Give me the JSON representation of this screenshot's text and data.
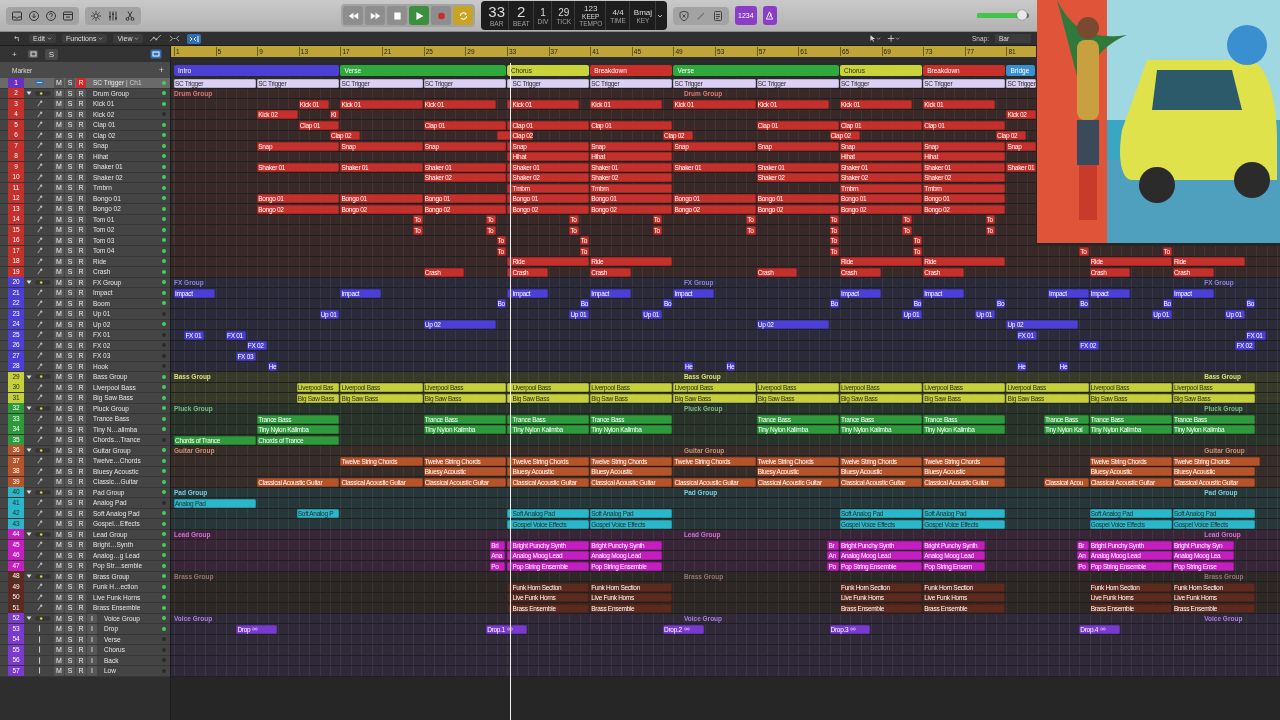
{
  "transport": [
    {
      "kind": "rewind",
      "on": false
    },
    {
      "kind": "forward",
      "on": false
    },
    {
      "kind": "stop",
      "on": false
    },
    {
      "kind": "play",
      "on": true
    },
    {
      "kind": "record",
      "on": false
    },
    {
      "kind": "cycle",
      "on": true
    }
  ],
  "lcd": [
    {
      "kind": "bar",
      "value": "33",
      "label": "BAR"
    },
    {
      "kind": "beat",
      "value": "2",
      "label": "BEAT"
    },
    {
      "kind": "div",
      "value": "1",
      "label": "DIV"
    },
    {
      "kind": "tick",
      "value": "29",
      "label": "TICK"
    },
    {
      "kind": "tempo",
      "value": "123",
      "sub": "KEEP",
      "label": "TEMPO"
    },
    {
      "kind": "time",
      "value": "4/4",
      "label": "TIME"
    },
    {
      "kind": "key",
      "value": "Bmaj",
      "label": "KEY"
    }
  ],
  "count_in": {
    "label": "1234",
    "on": true
  },
  "metronome": {
    "on": true
  },
  "master_volume": {
    "level": 0.86
  },
  "menus": [
    "Edit",
    "Functions",
    "View"
  ],
  "catch": {
    "on": true
  },
  "snap": {
    "label": "Snap:",
    "value": "Bar"
  },
  "tools_row": {
    "add": "+",
    "solo": "S"
  },
  "track_list_header": {
    "title": "Marker",
    "add": "+"
  },
  "ruler": [
    "1",
    "5",
    "9",
    "13",
    "17",
    "21",
    "25",
    "29",
    "33",
    "37",
    "41",
    "45",
    "49",
    "53",
    "57",
    "61",
    "65",
    "69",
    "73",
    "77",
    "81"
  ],
  "markers": [
    {
      "name": "Intro",
      "color": "#4b3fd6"
    },
    {
      "name": "Verse",
      "color": "#2fa83c"
    },
    {
      "name": "Chorus",
      "color": "#c9d43a"
    },
    {
      "name": "Breakdown",
      "color": "#c9302a"
    },
    {
      "name": "Verse",
      "color": "#2fa83c"
    },
    {
      "name": "Chorus",
      "color": "#c9d43a"
    },
    {
      "name": "Breakdown",
      "color": "#c9302a"
    },
    {
      "name": "Bridge",
      "color": "#3a8fd0"
    }
  ],
  "tracks": [
    {
      "number": "1",
      "name": "SC Trigger",
      "channel": "| Ch1",
      "kind": "trigger",
      "color": "#6b2fbf",
      "selected": true,
      "record": true,
      "active": true,
      "buttons": [
        "M",
        "S",
        "R"
      ],
      "regions": [
        "SC Trigger",
        "SC Trigger",
        "SC Trigger",
        "SC Trigger",
        "SC Trigger",
        "SC Trigger",
        "SC Trigger",
        "SC Trigger",
        "SC Trigger",
        "SC Trigger",
        "SC Trigger"
      ]
    },
    {
      "number": "2",
      "name": "Drum Group",
      "kind": "folder",
      "color": "#c4302b",
      "expanded": true,
      "selected": false,
      "record": false,
      "active": true,
      "buttons": [
        "M",
        "S",
        "R"
      ],
      "labels": [
        "Drum Group",
        "Drum Group"
      ],
      "children": [
        {
          "number": "3",
          "name": "Kick 01",
          "kind": "track",
          "selected": false,
          "record": false,
          "active": true,
          "buttons": [
            "M",
            "S",
            "R"
          ],
          "regions": [
            "Kick 01",
            "Kick 01",
            "Kick 01",
            "Kick 01",
            "Kick 01",
            "Kick 01",
            "Kick 01",
            "Kick 01",
            "Kick 01"
          ]
        },
        {
          "number": "4",
          "name": "Kick 02",
          "kind": "track",
          "selected": false,
          "record": false,
          "active": false,
          "buttons": [
            "M",
            "S",
            "R"
          ],
          "regions": [
            "Kick 02",
            "Ki",
            "Kick 02"
          ]
        },
        {
          "number": "5",
          "name": "Clap 01",
          "kind": "track",
          "selected": false,
          "record": false,
          "active": true,
          "buttons": [
            "M",
            "S",
            "R"
          ],
          "regions": [
            "Clap 01",
            "Clap 01",
            "Clap 01",
            "Clap 01",
            "Clap 01",
            "Clap 01",
            "Clap 01"
          ]
        },
        {
          "number": "6",
          "name": "Clap 02",
          "kind": "track",
          "selected": false,
          "record": false,
          "active": true,
          "buttons": [
            "M",
            "S",
            "R"
          ],
          "regions": [
            "Clap 02",
            "Clap 02",
            "Clap 02",
            "Clap 02",
            "Clap 02"
          ]
        },
        {
          "number": "7",
          "name": "Snap",
          "kind": "track",
          "selected": false,
          "record": false,
          "active": true,
          "buttons": [
            "M",
            "S",
            "R"
          ],
          "regions": [
            "Snap",
            "Snap",
            "Snap",
            "Snap",
            "Snap",
            "Snap",
            "Snap",
            "Snap",
            "Snap",
            "Snap"
          ]
        },
        {
          "number": "8",
          "name": "Hihat",
          "kind": "track",
          "selected": false,
          "record": false,
          "active": true,
          "buttons": [
            "M",
            "S",
            "R"
          ],
          "regions": [
            "Hihat",
            "Hihat",
            "Hihat",
            "Hihat"
          ]
        },
        {
          "number": "9",
          "name": "Shaker 01",
          "kind": "track",
          "selected": false,
          "record": false,
          "active": true,
          "buttons": [
            "M",
            "S",
            "R"
          ],
          "regions": [
            "Shaker 01",
            "Shaker 01",
            "Shaker 01",
            "Shaker 01",
            "Shaker 01",
            "Shaker 01",
            "Shaker 01",
            "Shaker 01",
            "Shaker 01",
            "Shaker 01"
          ]
        },
        {
          "number": "10",
          "name": "Shaker 02",
          "kind": "track",
          "selected": false,
          "record": false,
          "active": true,
          "buttons": [
            "M",
            "S",
            "R"
          ],
          "regions": [
            "Shaker 02",
            "Shaker 02",
            "Shaker 02",
            "Shaker 02",
            "Shaker 02",
            "Shaker 02"
          ]
        },
        {
          "number": "11",
          "name": "Tmbrn",
          "kind": "track",
          "selected": false,
          "record": false,
          "active": true,
          "buttons": [
            "M",
            "S",
            "R"
          ],
          "regions": [
            "Tmbrn",
            "Tmbrn",
            "Tmbrn",
            "Tmbrn"
          ]
        },
        {
          "number": "12",
          "name": "Bongo 01",
          "kind": "track",
          "selected": false,
          "record": false,
          "active": true,
          "buttons": [
            "M",
            "S",
            "R"
          ],
          "regions": [
            "Bongo 01",
            "Bongo 01",
            "Bongo 01",
            "Bongo 01",
            "Bongo 01",
            "Bongo 01",
            "Bongo 01",
            "Bongo 01",
            "Bongo 01"
          ]
        },
        {
          "number": "13",
          "name": "Bongo 02",
          "kind": "track",
          "selected": false,
          "record": false,
          "active": true,
          "buttons": [
            "M",
            "S",
            "R"
          ],
          "regions": [
            "Bongo 02",
            "Bongo 02",
            "Bongo 02",
            "Bongo 02",
            "Bongo 02",
            "Bongo 02",
            "Bongo 02",
            "Bongo 02",
            "Bongo 02"
          ]
        },
        {
          "number": "14",
          "name": "Tom 01",
          "kind": "track",
          "selected": false,
          "record": false,
          "active": true,
          "buttons": [
            "M",
            "S",
            "R"
          ],
          "regions": [
            "To",
            "To",
            "To",
            "To",
            "To",
            "To",
            "To",
            "To"
          ]
        },
        {
          "number": "15",
          "name": "Tom 02",
          "kind": "track",
          "selected": false,
          "record": false,
          "active": true,
          "buttons": [
            "M",
            "S",
            "R"
          ],
          "regions": [
            "To",
            "To",
            "To",
            "To",
            "To",
            "To",
            "To",
            "To"
          ]
        },
        {
          "number": "16",
          "name": "Tom 03",
          "kind": "track",
          "selected": false,
          "record": false,
          "active": true,
          "buttons": [
            "M",
            "S",
            "R"
          ],
          "regions": [
            "To",
            "To",
            "To",
            "To"
          ]
        },
        {
          "number": "17",
          "name": "Tom 04",
          "kind": "track",
          "selected": false,
          "record": false,
          "active": true,
          "buttons": [
            "M",
            "S",
            "R"
          ],
          "regions": [
            "To",
            "To",
            "To",
            "To",
            "To",
            "To"
          ]
        },
        {
          "number": "18",
          "name": "Ride",
          "kind": "track",
          "selected": false,
          "record": false,
          "active": true,
          "buttons": [
            "M",
            "S",
            "R"
          ],
          "regions": [
            "Ride",
            "Ride",
            "Ride",
            "Ride",
            "Ride",
            "Ride"
          ]
        },
        {
          "number": "19",
          "name": "Crash",
          "kind": "track",
          "selected": false,
          "record": false,
          "active": true,
          "buttons": [
            "M",
            "S",
            "R"
          ],
          "regions": [
            "Crash",
            "Crash",
            "Crash",
            "Crash",
            "Crash",
            "Crash",
            "Crash",
            "Crash"
          ]
        }
      ]
    },
    {
      "number": "20",
      "name": "FX Group",
      "kind": "folder",
      "color": "#4b3fd6",
      "expanded": true,
      "selected": false,
      "record": false,
      "active": true,
      "buttons": [
        "M",
        "S",
        "R"
      ],
      "labels": [
        "FX Group",
        "FX Group",
        "FX Group"
      ],
      "children": [
        {
          "number": "21",
          "name": "Impact",
          "kind": "track",
          "selected": false,
          "record": false,
          "active": true,
          "buttons": [
            "M",
            "S",
            "R"
          ],
          "regions": [
            "Impact",
            "Impact",
            "Impact",
            "Impact",
            "Impact",
            "Impact",
            "Impact",
            "Impact",
            "Impact",
            "Impact"
          ]
        },
        {
          "number": "22",
          "name": "Boom",
          "kind": "track",
          "selected": false,
          "record": false,
          "active": true,
          "buttons": [
            "M",
            "S",
            "R"
          ],
          "regions": [
            "Bo",
            "Bo",
            "Bo",
            "Bo",
            "Bo",
            "Bo",
            "Bo",
            "Bo",
            "Bo"
          ]
        },
        {
          "number": "23",
          "name": "Up 01",
          "kind": "track",
          "selected": false,
          "record": false,
          "active": false,
          "buttons": [
            "M",
            "S",
            "R"
          ],
          "regions": [
            "Up 01",
            "Up 01",
            "Up 01",
            "Up 01",
            "Up 01",
            "Up 01",
            "Up 01"
          ]
        },
        {
          "number": "24",
          "name": "Up 02",
          "kind": "track",
          "selected": false,
          "record": false,
          "active": true,
          "buttons": [
            "M",
            "S",
            "R"
          ],
          "regions": [
            "Up 02",
            "Up 02",
            "Up 02"
          ]
        },
        {
          "number": "25",
          "name": "FX 01",
          "kind": "track",
          "selected": false,
          "record": false,
          "active": false,
          "buttons": [
            "M",
            "S",
            "R"
          ],
          "regions": [
            "FX 01",
            "FX 01",
            "FX 01",
            "FX 01"
          ]
        },
        {
          "number": "26",
          "name": "FX 02",
          "kind": "track",
          "selected": false,
          "record": false,
          "active": false,
          "buttons": [
            "M",
            "S",
            "R"
          ],
          "regions": [
            "FX 02",
            "FX 02",
            "FX 02"
          ]
        },
        {
          "number": "27",
          "name": "FX 03",
          "kind": "track",
          "selected": false,
          "record": false,
          "active": false,
          "buttons": [
            "M",
            "S",
            "R"
          ],
          "regions": [
            "FX 03"
          ]
        },
        {
          "number": "28",
          "name": "Hook",
          "kind": "track",
          "selected": false,
          "record": false,
          "active": false,
          "buttons": [
            "M",
            "S",
            "R"
          ],
          "regions": [
            "He",
            "He",
            "He",
            "He",
            "He"
          ]
        }
      ]
    },
    {
      "number": "29",
      "name": "Bass Group",
      "kind": "folder",
      "color": "#c6d03a",
      "expanded": true,
      "selected": false,
      "record": false,
      "active": true,
      "buttons": [
        "M",
        "S",
        "R"
      ],
      "labels": [
        "Bass Group",
        "Bass Group",
        "Bass Group"
      ],
      "children": [
        {
          "number": "30",
          "name": "Liverpool Bass",
          "kind": "track",
          "selected": false,
          "record": false,
          "active": true,
          "buttons": [
            "M",
            "S",
            "R"
          ],
          "regions": [
            "Liverpool Bas",
            "Liverpool Bass",
            "Liverpool Bass",
            "Liverpool Bass",
            "Liverpool Bass",
            "Liverpool Bass",
            "Liverpool Bass",
            "Liverpool Bass",
            "Liverpool Bass",
            "Liverpool Bass",
            "Liverpool Bass",
            "Liverpool Bass"
          ]
        },
        {
          "number": "31",
          "name": "Big Saw Bass",
          "kind": "track",
          "selected": false,
          "record": false,
          "active": true,
          "buttons": [
            "M",
            "S",
            "R"
          ],
          "regions": [
            "Big Saw Bass",
            "Big Saw Bass",
            "Big Saw Bass",
            "Big Saw Bass",
            "Big Saw Bass",
            "Big Saw Bass",
            "Big Saw Bass",
            "Big Saw Bass",
            "Big Saw Bass",
            "Big Saw Bass",
            "Big Saw Bass",
            "Big Saw Bass"
          ]
        }
      ]
    },
    {
      "number": "32",
      "name": "Pluck Group",
      "kind": "folder",
      "color": "#2f9a3c",
      "expanded": true,
      "selected": false,
      "record": false,
      "active": true,
      "buttons": [
        "M",
        "S",
        "R"
      ],
      "labels": [
        "Pluck Group",
        "Pluck Group",
        "Pluck Group"
      ],
      "children": [
        {
          "number": "33",
          "name": "Trance Bass",
          "kind": "track",
          "selected": false,
          "record": false,
          "active": true,
          "buttons": [
            "M",
            "S",
            "R"
          ],
          "regions": [
            "Trance Bass",
            "Trance Bass",
            "Trance Bass",
            "Trance Bass",
            "Trance Bass",
            "Trance Bass",
            "Trance Bass",
            "Trance Bass",
            "Trance Bass",
            "Trance Bass"
          ]
        },
        {
          "number": "34",
          "name": "Tiny N…alimba",
          "kind": "track",
          "selected": false,
          "record": false,
          "active": true,
          "buttons": [
            "M",
            "S",
            "R"
          ],
          "regions": [
            "Tiny Nylon Kalimba",
            "Tiny Nylon Kalimba",
            "Tiny Nylon Kalimba",
            "Tiny Nylon Kalimba",
            "Tiny Nylon Kalimba",
            "Tiny Nylon Kalimba",
            "Tiny Nylon Kalimba",
            "Tiny Nylon Kal",
            "Tiny Nylon Kalimba",
            "Tiny Nylon Kalimba"
          ]
        },
        {
          "number": "35",
          "name": "Chords…Trance",
          "kind": "track",
          "selected": false,
          "record": false,
          "active": false,
          "buttons": [
            "M",
            "S",
            "R"
          ],
          "regions": [
            "Chords of Trance",
            "Chords of Trance"
          ]
        }
      ]
    },
    {
      "number": "36",
      "name": "Guitar Group",
      "kind": "folder",
      "color": "#b5532a",
      "expanded": true,
      "selected": false,
      "record": false,
      "active": true,
      "buttons": [
        "M",
        "S",
        "R"
      ],
      "labels": [
        "Guitar Group",
        "Guitar Group",
        "Guitar Group"
      ],
      "children": [
        {
          "number": "37",
          "name": "Twelve…Chords",
          "kind": "track",
          "selected": false,
          "record": false,
          "active": true,
          "buttons": [
            "M",
            "S",
            "R"
          ],
          "regions": [
            "Twelve String Chords",
            "Twelve String Chords",
            "Twelve String Chords",
            "Twelve String Chords",
            "Twelve String Chords",
            "Twelve String Chords",
            "Twelve String Chords",
            "Twelve String Chords",
            "Twelve String Chords",
            "Twelve String Chords"
          ]
        },
        {
          "number": "38",
          "name": "Bluesy Acoustic",
          "kind": "track",
          "selected": false,
          "record": false,
          "active": true,
          "buttons": [
            "M",
            "S",
            "R"
          ],
          "regions": [
            "Bluesy Acoustic",
            "Bluesy Acoustic",
            "Bluesy Acoustic",
            "Bluesy Acoustic",
            "Bluesy Acoustic",
            "Bluesy Acoustic",
            "Bluesy Acoustic",
            "Bluesy Acoustic"
          ]
        },
        {
          "number": "39",
          "name": "Classic…Guitar",
          "kind": "track",
          "selected": false,
          "record": false,
          "active": true,
          "buttons": [
            "M",
            "S",
            "R"
          ],
          "regions": [
            "Classical Acoustic Guitar",
            "Classical Acoustic Guitar",
            "Classical Acoustic Guitar",
            "Classical Acoustic Guitar",
            "Classical Acoustic Guitar",
            "Classical Acoustic Guitar",
            "Classical Acoustic Guitar",
            "Classical Acoustic Guitar",
            "Classical Acoustic Guitar",
            "Classical Acou",
            "Classical Acoustic Guitar",
            "Classical Acoustic Guitar"
          ]
        }
      ]
    },
    {
      "number": "40",
      "name": "Pad Group",
      "kind": "folder",
      "color": "#2ab7c9",
      "expanded": true,
      "selected": false,
      "record": false,
      "active": true,
      "buttons": [
        "M",
        "S",
        "R"
      ],
      "labels": [
        "Pad Group",
        "Pad Group",
        "Pad Group"
      ],
      "children": [
        {
          "number": "41",
          "name": "Analog Pad",
          "kind": "track",
          "selected": false,
          "record": false,
          "active": false,
          "buttons": [
            "M",
            "S",
            "R"
          ],
          "regions": [
            "Analog Pad"
          ]
        },
        {
          "number": "42",
          "name": "Soft Analog Pad",
          "kind": "track",
          "selected": false,
          "record": false,
          "active": true,
          "buttons": [
            "M",
            "S",
            "R"
          ],
          "regions": [
            "Soft Analog P",
            "Soft Analog Pad",
            "Soft Analog Pad",
            "Soft Analog Pad",
            "Soft Analog Pad",
            "Soft Analog Pad",
            "Soft Analog Pad"
          ]
        },
        {
          "number": "43",
          "name": "Gospel…Effects",
          "kind": "track",
          "selected": false,
          "record": false,
          "active": true,
          "buttons": [
            "M",
            "S",
            "R"
          ],
          "regions": [
            "Gospel Voice Effects",
            "Gospel Voice Effects",
            "Gospel Voice Effects",
            "Gospel Voice Effects",
            "Gospel Voice Effects",
            "Gospel Voice Effects"
          ]
        }
      ]
    },
    {
      "number": "44",
      "name": "Lead Group",
      "kind": "folder",
      "color": "#c41ec0",
      "expanded": true,
      "selected": false,
      "record": false,
      "active": true,
      "buttons": [
        "M",
        "S",
        "R"
      ],
      "labels": [
        "Lead Group",
        "Lead Group",
        "Lead Group"
      ],
      "children": [
        {
          "number": "45",
          "name": "Bright…Synth",
          "kind": "track",
          "selected": false,
          "record": false,
          "active": true,
          "buttons": [
            "M",
            "S",
            "R"
          ],
          "regions": [
            "Bri",
            "Bright Punchy Synth",
            "Bright Punchy Synth",
            "Br",
            "Bright Punchy Synth",
            "Bright Punchy Synth",
            "Br",
            "Bright Punchy Synth",
            "Bright Punchy Syn"
          ]
        },
        {
          "number": "46",
          "name": "Analog…g Lead",
          "kind": "track",
          "selected": false,
          "record": false,
          "active": true,
          "buttons": [
            "M",
            "S",
            "R"
          ],
          "regions": [
            "Ana",
            "Analog Moog Lead",
            "Analog Moog Lead",
            "An",
            "Analog Moog Lead",
            "Analog Moog Lead",
            "An",
            "Analog Moog Lead",
            "Analog Moog Lea"
          ]
        },
        {
          "number": "47",
          "name": "Pop Str…semble",
          "kind": "track",
          "selected": false,
          "record": false,
          "active": true,
          "buttons": [
            "M",
            "S",
            "R"
          ],
          "regions": [
            "Po",
            "Pop String Ensemble",
            "Pop String Ensemble",
            "Po",
            "Pop String Ensemble",
            "Pop String Ensem",
            "Po",
            "Pop String Ensemble",
            "Pop String Ense"
          ]
        }
      ]
    },
    {
      "number": "48",
      "name": "Brass Group",
      "kind": "folder",
      "color": "#5c2a1f",
      "expanded": true,
      "selected": false,
      "record": false,
      "active": true,
      "buttons": [
        "M",
        "S",
        "R"
      ],
      "labels": [
        "Brass Group",
        "Brass Group",
        "Brass Group"
      ],
      "children": [
        {
          "number": "49",
          "name": "Funk H…ection",
          "kind": "track",
          "selected": false,
          "record": false,
          "active": true,
          "buttons": [
            "M",
            "S",
            "R"
          ],
          "regions": [
            "Funk Horn Section",
            "Funk Horn Section",
            "Funk Horn Section",
            "Funk Horn Section",
            "Funk Horn Section",
            "Funk Horn Section"
          ]
        },
        {
          "number": "50",
          "name": "Live Funk Horns",
          "kind": "track",
          "selected": false,
          "record": false,
          "active": true,
          "buttons": [
            "M",
            "S",
            "R"
          ],
          "regions": [
            "Live Funk Horns",
            "Live Funk Horns",
            "Live Funk Horns",
            "Live Funk Horns",
            "Live Funk Horns",
            "Live Funk Horns"
          ]
        },
        {
          "number": "51",
          "name": "Brass Ensemble",
          "kind": "track",
          "selected": false,
          "record": false,
          "active": true,
          "buttons": [
            "M",
            "S",
            "R"
          ],
          "regions": [
            "Brass Ensemble",
            "Brass Ensemble",
            "Brass Ensemble",
            "Brass Ensemble",
            "Brass Ensemble",
            "Brass Ensemble"
          ]
        }
      ]
    },
    {
      "number": "52",
      "name": "Voice Group",
      "kind": "folder",
      "color": "#7a3ad0",
      "expanded": true,
      "selected": false,
      "record": false,
      "active": true,
      "buttons": [
        "M",
        "S",
        "R",
        "I"
      ],
      "labels": [
        "Voice Group",
        "Voice Group",
        "Voice Group"
      ],
      "children": [
        {
          "number": "53",
          "name": "Drop",
          "kind": "audio",
          "selected": false,
          "record": false,
          "active": true,
          "buttons": [
            "M",
            "S",
            "R",
            "I"
          ],
          "regions": [
            "Drop",
            "Drop.1",
            "Drop.2",
            "Drop.3",
            "Drop.4"
          ]
        },
        {
          "number": "54",
          "name": "Verse",
          "kind": "audio",
          "selected": false,
          "record": false,
          "active": false,
          "buttons": [
            "M",
            "S",
            "R",
            "I"
          ]
        },
        {
          "number": "55",
          "name": "Chorus",
          "kind": "audio",
          "selected": false,
          "record": false,
          "active": false,
          "buttons": [
            "M",
            "S",
            "R",
            "I"
          ]
        },
        {
          "number": "56",
          "name": "Back",
          "kind": "audio",
          "selected": false,
          "record": false,
          "active": false,
          "buttons": [
            "M",
            "S",
            "R",
            "I"
          ]
        },
        {
          "number": "57",
          "name": "Low",
          "kind": "audio",
          "selected": false,
          "record": false,
          "active": false,
          "buttons": [
            "M",
            "S",
            "R",
            "I"
          ]
        }
      ]
    }
  ]
}
